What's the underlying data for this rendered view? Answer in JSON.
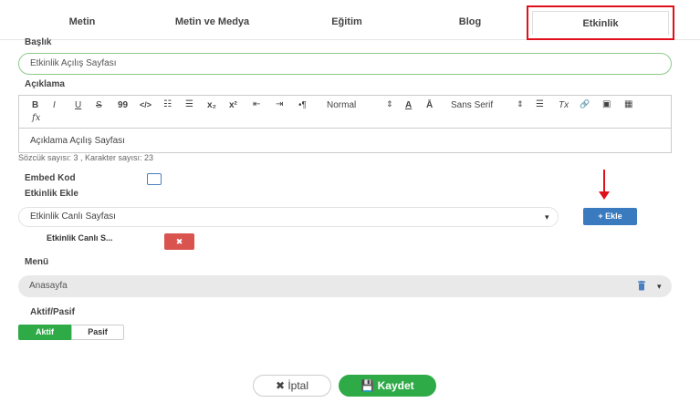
{
  "tabs": [
    {
      "label": "Metin"
    },
    {
      "label": "Metin ve Medya"
    },
    {
      "label": "Eğitim"
    },
    {
      "label": "Blog"
    },
    {
      "label": "Etkinlik"
    }
  ],
  "form": {
    "title_label": "Başlık",
    "title_value": "Etkinlik Açılış Sayfası",
    "description_label": "Açıklama",
    "description_value": "Açıklama Açılış Sayfası",
    "word_count": "Sözcük sayısı: 3 , Karakter sayısı: 23",
    "embed_label": "Embed Kod",
    "event_add_label": "Etkinlik Ekle",
    "event_select_value": "Etkinlik Canlı Sayfası",
    "add_button": "+ Ekle",
    "event_item": "Etkinlik Canlı S...",
    "delete_button": "✖",
    "menu_label": "Menü",
    "menu_value": "Anasayfa",
    "status_label": "Aktif/Pasif",
    "active_label": "Aktif",
    "passive_label": "Pasif",
    "cancel_button": "✖ İptal",
    "save_button": "💾 Kaydet"
  },
  "toolbar": {
    "bold": "B",
    "italic": "I",
    "underline": "U",
    "strike": "S",
    "quote": "99",
    "code": "</>",
    "ordered_list": "☷",
    "bullet_list": "☰",
    "subscript": "x₂",
    "superscript": "x²",
    "outdent": "⇤",
    "indent": "⇥",
    "direction": "•¶",
    "heading": "Normal",
    "heading_caret": "⇕",
    "font_color": "A",
    "background_color": "Ā",
    "font": "Sans Serif",
    "font_caret": "⇕",
    "align": "☰",
    "clear_format": "Tx",
    "link": "🔗",
    "image": "▣",
    "video": "▦",
    "formula": "fx"
  },
  "colors": {
    "active_tab_outline": "#e0101a",
    "primary": "#3a7bbf",
    "success": "#2eaa47",
    "danger": "#d9534f"
  }
}
